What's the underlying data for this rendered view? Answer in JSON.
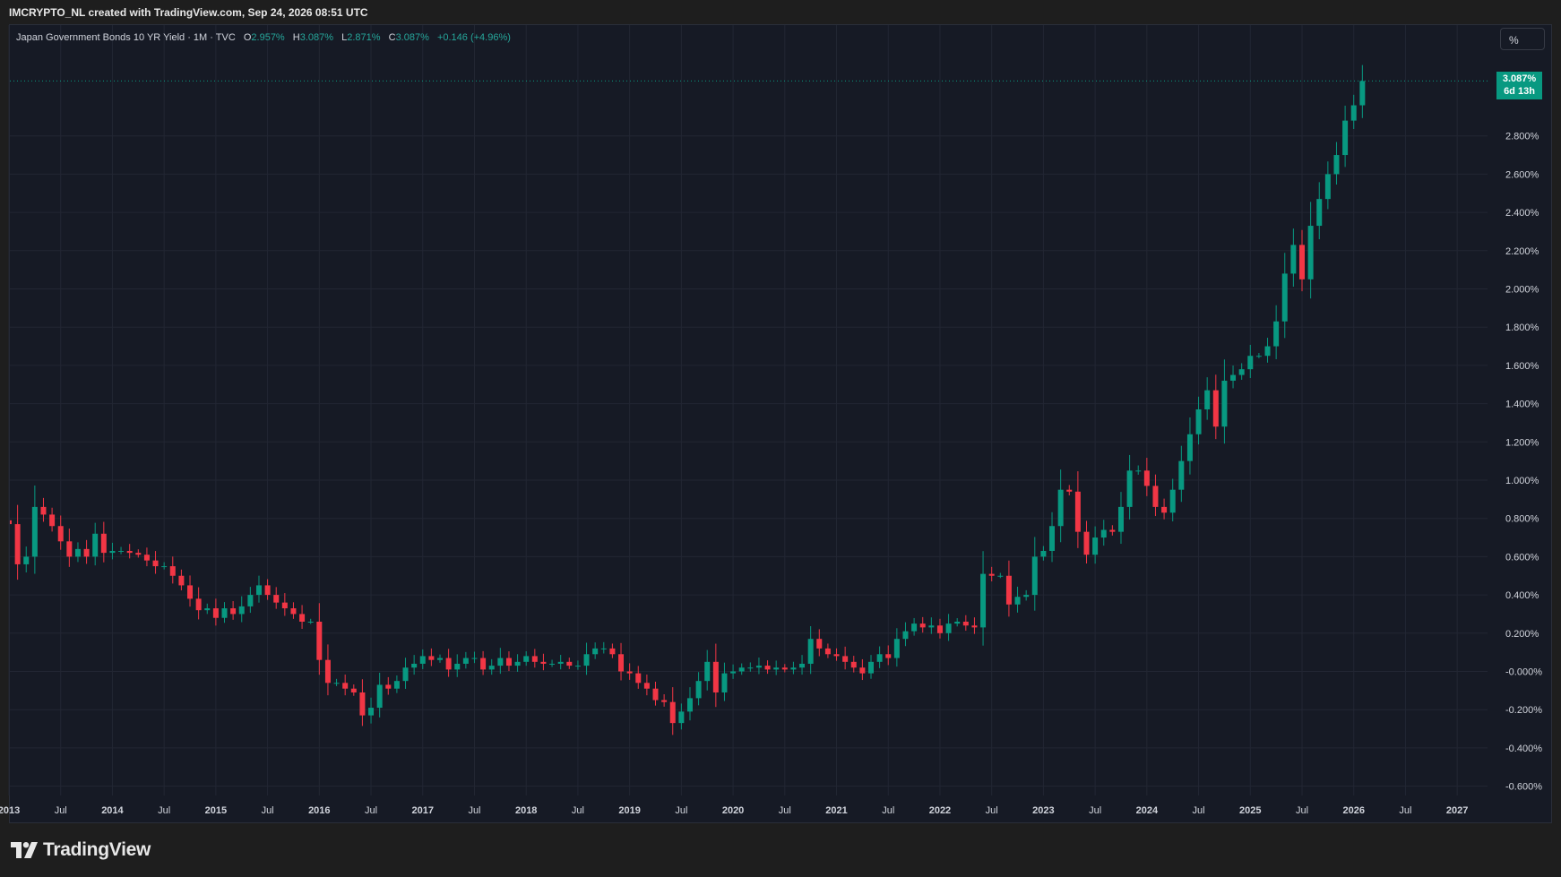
{
  "header": {
    "credit": "IMCRYPTO_NL created with TradingView.com, Sep 24, 2026 08:51 UTC"
  },
  "legend": {
    "symbol": "Japan Government Bonds 10 YR Yield · 1M · TVC",
    "open_label": "O",
    "open": "2.957%",
    "high_label": "H",
    "high": "3.087%",
    "low_label": "L",
    "low": "2.871%",
    "close_label": "C",
    "close": "3.087%",
    "change": "+0.146 (+4.96%)"
  },
  "scale_button": "%",
  "price_tag": {
    "price": "3.087%",
    "countdown": "6d 13h"
  },
  "brand": {
    "name": "TradingView",
    "icon": "tradingview-logo-icon"
  },
  "colors": {
    "up": "#089981",
    "down": "#f23645",
    "background": "#161a25",
    "grid": "#222633"
  },
  "chart_data": {
    "type": "candlestick",
    "interval": "1M",
    "unit": "%",
    "y_range": [
      -0.6,
      3.087
    ],
    "y_ticks": [
      3.087,
      2.8,
      2.6,
      2.4,
      2.2,
      2.0,
      1.8,
      1.6,
      1.4,
      1.2,
      1.0,
      0.8,
      0.6,
      0.4,
      0.2,
      0.0,
      -0.2,
      -0.4,
      -0.6
    ],
    "y_tick_labels": [
      "2.800%",
      "2.600%",
      "2.400%",
      "2.200%",
      "2.000%",
      "1.800%",
      "1.600%",
      "1.400%",
      "1.200%",
      "1.000%",
      "0.800%",
      "0.600%",
      "0.400%",
      "0.200%",
      "-0.000%",
      "-0.200%",
      "-0.400%",
      "-0.600%"
    ],
    "x_tick_labels": [
      "2013",
      "Jul",
      "2014",
      "Jul",
      "2015",
      "Jul",
      "2016",
      "Jul",
      "2017",
      "Jul",
      "2018",
      "Jul",
      "2019",
      "Jul",
      "2020",
      "Jul",
      "2021",
      "Jul",
      "2022",
      "Jul",
      "2023",
      "Jul",
      "2024",
      "Jul",
      "2025",
      "Jul",
      "2026",
      "Jul",
      "2027"
    ],
    "start": "2013-01",
    "series_note": "one value per month, Jan 2013 to Sep 2026 (close)",
    "closes": [
      0.77,
      0.56,
      0.6,
      0.86,
      0.82,
      0.76,
      0.68,
      0.6,
      0.64,
      0.6,
      0.72,
      0.62,
      0.63,
      0.63,
      0.62,
      0.61,
      0.58,
      0.55,
      0.55,
      0.5,
      0.45,
      0.38,
      0.32,
      0.33,
      0.28,
      0.33,
      0.3,
      0.34,
      0.4,
      0.45,
      0.4,
      0.36,
      0.33,
      0.3,
      0.26,
      0.26,
      0.06,
      -0.06,
      -0.06,
      -0.09,
      -0.11,
      -0.23,
      -0.19,
      -0.07,
      -0.09,
      -0.05,
      0.02,
      0.04,
      0.08,
      0.06,
      0.07,
      0.01,
      0.04,
      0.07,
      0.07,
      0.01,
      0.03,
      0.07,
      0.03,
      0.05,
      0.08,
      0.05,
      0.04,
      0.04,
      0.05,
      0.03,
      0.03,
      0.09,
      0.12,
      0.12,
      0.09,
      0.0,
      -0.01,
      -0.06,
      -0.09,
      -0.15,
      -0.16,
      -0.27,
      -0.21,
      -0.14,
      -0.05,
      0.05,
      -0.11,
      -0.01,
      0.0,
      0.02,
      0.02,
      0.03,
      0.01,
      0.02,
      0.01,
      0.02,
      0.04,
      0.17,
      0.12,
      0.09,
      0.08,
      0.05,
      0.02,
      -0.01,
      0.05,
      0.09,
      0.07,
      0.17,
      0.21,
      0.25,
      0.23,
      0.24,
      0.2,
      0.25,
      0.26,
      0.24,
      0.23,
      0.51,
      0.5,
      0.5,
      0.35,
      0.39,
      0.4,
      0.6,
      0.63,
      0.76,
      0.95,
      0.94,
      0.73,
      0.61,
      0.7,
      0.74,
      0.73,
      0.86,
      1.05,
      1.05,
      0.97,
      0.86,
      0.83,
      0.95,
      1.1,
      1.24,
      1.37,
      1.47,
      1.28,
      1.52,
      1.55,
      1.58,
      1.65,
      1.65,
      1.7,
      1.83,
      2.08,
      2.23,
      2.05,
      2.33,
      2.47,
      2.6,
      2.7,
      2.88,
      2.96,
      3.087
    ],
    "title": "Japan Government Bonds 10 YR Yield"
  }
}
